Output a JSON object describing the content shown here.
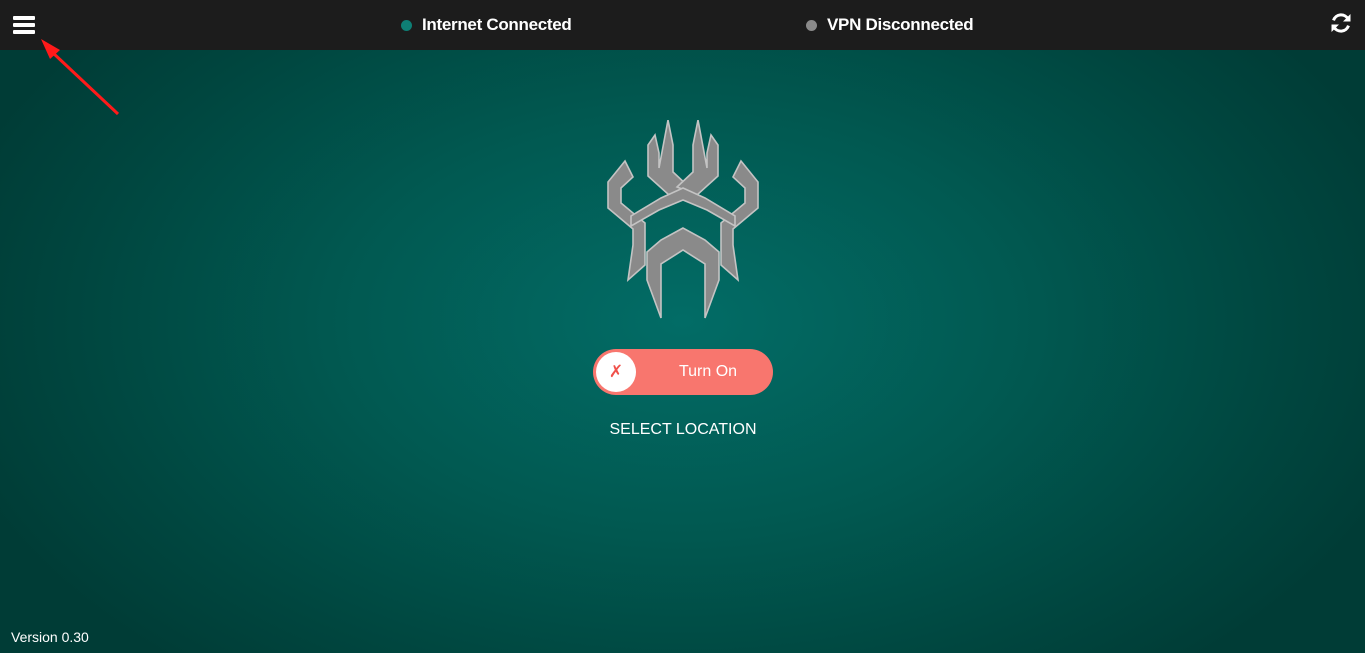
{
  "header": {
    "menu_icon": "hamburger-icon",
    "internet_status": {
      "label": "Internet Connected",
      "color": "#0e7f75"
    },
    "vpn_status": {
      "label": "VPN Disconnected",
      "color": "#8a8a8a"
    },
    "refresh_icon": "refresh-icon"
  },
  "main": {
    "logo_icon": "spider-logo-icon",
    "toggle": {
      "label": "Turn On",
      "knob_symbol": "✗",
      "color": "#f8766e"
    },
    "select_location_label": "SELECT LOCATION"
  },
  "footer": {
    "version": "Version 0.30"
  },
  "annotation": {
    "type": "arrow",
    "color": "#ff1a1a",
    "target": "hamburger-icon"
  }
}
